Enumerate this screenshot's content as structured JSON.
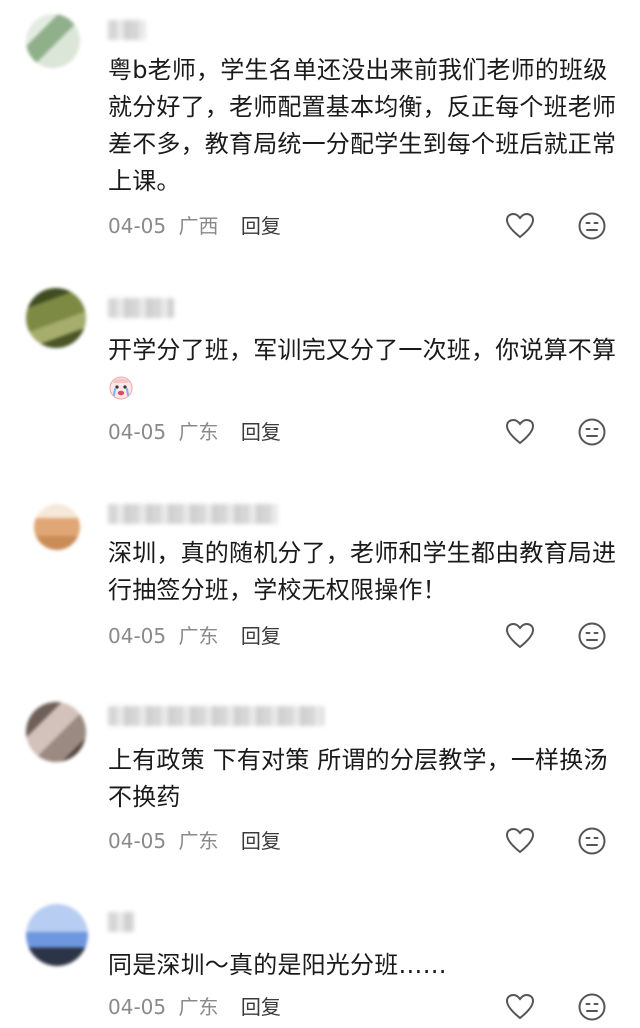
{
  "comments": [
    {
      "text": "粤b老师，学生名单还没出来前我们老师的班级就分好了，老师配置基本均衡，反正每个班老师差不多，教育局统一分配学生到每个班后就正常上课。",
      "date": "04-05",
      "region": "广西",
      "reply": "回复",
      "avatar_colors": [
        "#c9d9c7",
        "#7ea27a",
        "#e7eee5"
      ]
    },
    {
      "text": "开学分了班，军训完又分了一次班，你说算不算",
      "emoji": "crying-baby-emoji",
      "date": "04-05",
      "region": "广东",
      "reply": "回复",
      "avatar_colors": [
        "#5b6a2c",
        "#8f9a55",
        "#3d4a1d"
      ]
    },
    {
      "text": "深圳，真的随机分了，老师和学生都由教育局进行抽签分班，学校无权限操作！",
      "date": "04-05",
      "region": "广东",
      "reply": "回复",
      "avatar_colors": [
        "#e8b98c",
        "#d0925a",
        "#f3e3d2"
      ]
    },
    {
      "text": "上有政策 下有对策 所谓的分层教学，一样换汤不换药",
      "date": "04-05",
      "region": "广东",
      "reply": "回复",
      "avatar_colors": [
        "#8a7a70",
        "#c9b7b0",
        "#5a4a44"
      ]
    },
    {
      "text": "同是深圳～真的是阳光分班……",
      "date": "04-05",
      "region": "广东",
      "reply": "回复",
      "avatar_colors": [
        "#a9c4ef",
        "#5e8bd8",
        "#2f3a52"
      ]
    }
  ],
  "icons": {
    "like": "heart-outline-icon",
    "dislike": "neutral-face-icon"
  },
  "colors": {
    "text": "#1a1a1a",
    "meta": "#8a8a8a",
    "reply": "#3a3a3a",
    "icon": "#555555"
  }
}
